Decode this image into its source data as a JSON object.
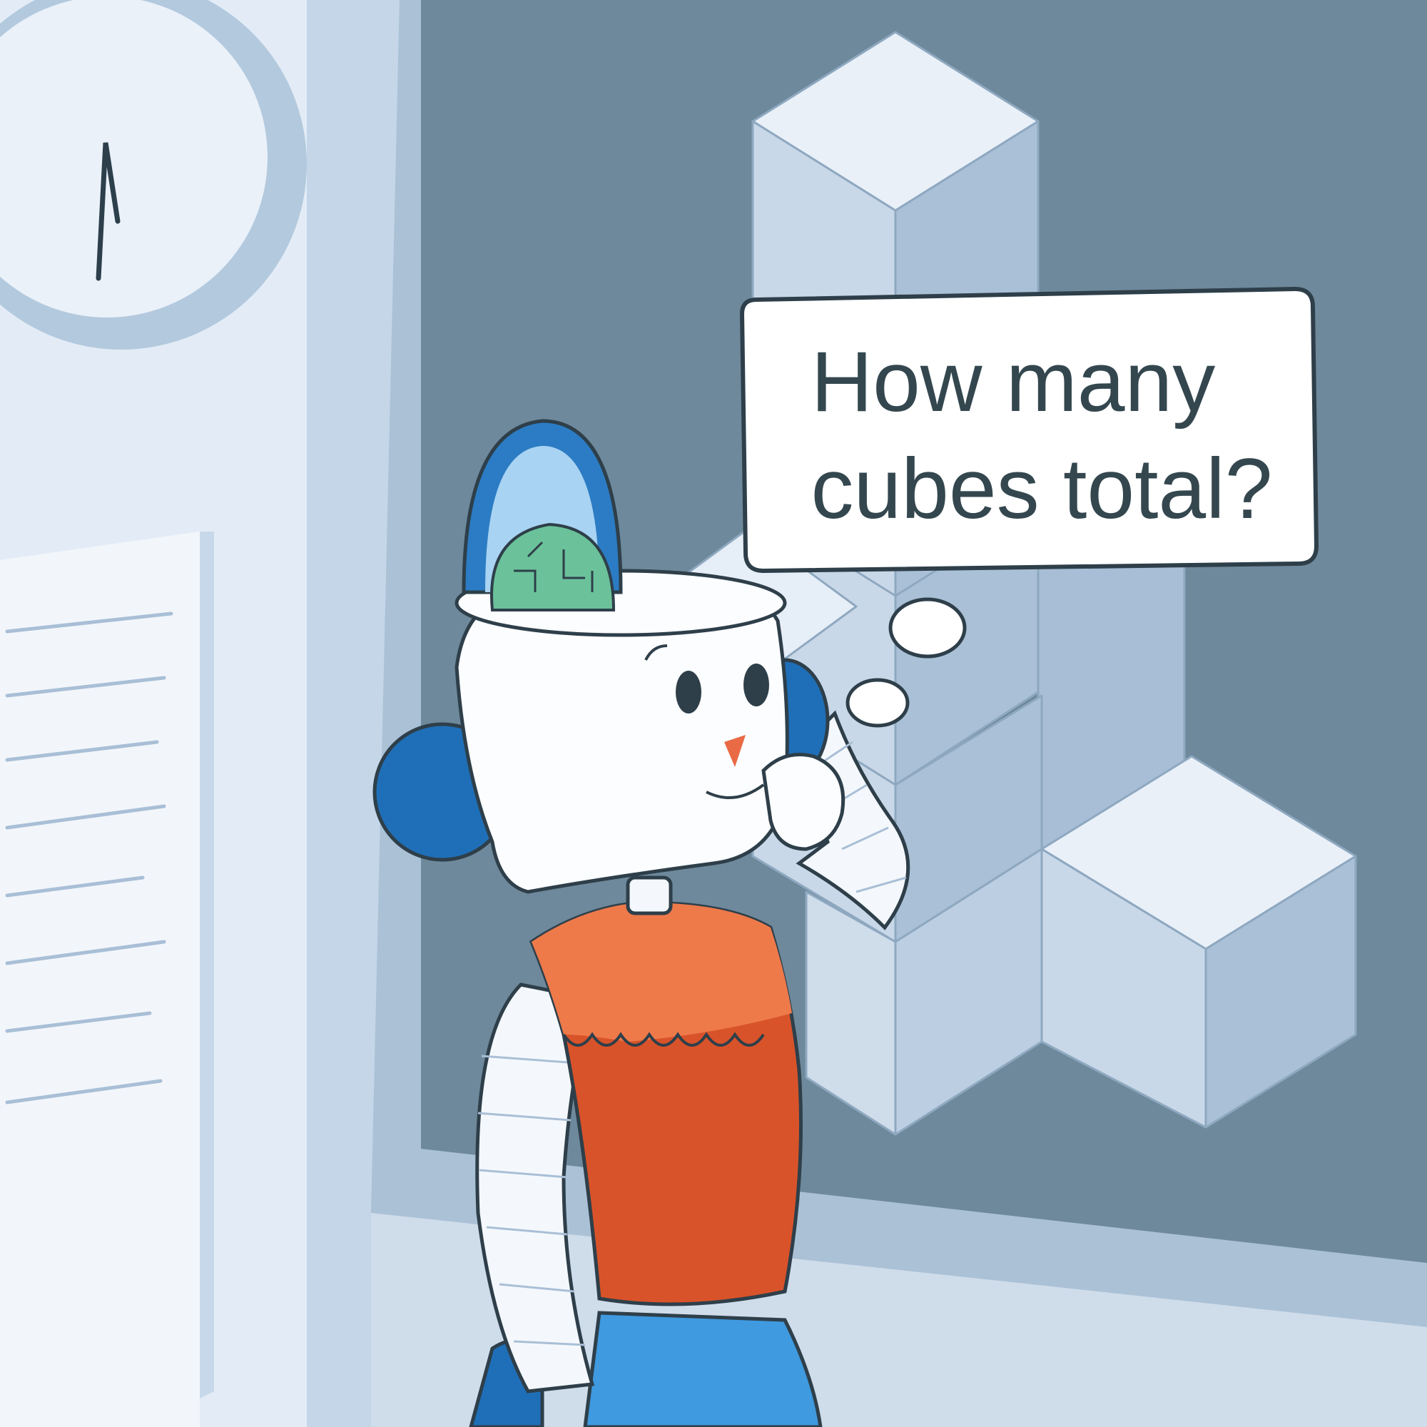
{
  "speech_bubble": {
    "line1": "How many",
    "line2": "cubes total?"
  },
  "colors": {
    "wall": "#dde8f3",
    "wall_shade": "#b9cde0",
    "board": "#6f8a9c",
    "board_frame": "#a9bfd2",
    "cube_top": "#e9f0f8",
    "cube_left": "#c9d8e8",
    "cube_right": "#a8bfd6",
    "outline": "#2e3f4a",
    "robot_white": "#fbfdff",
    "robot_blue": "#1f6fb8",
    "robot_blue_light": "#3f9ae0",
    "vest_orange": "#d9532a",
    "vest_orange_light": "#ee7a4a",
    "chip_green": "#6bc29a",
    "nose": "#e96a45",
    "text": "#34474f"
  },
  "icons": [
    "wall-clock-icon",
    "notice-paper-icon",
    "cube-stack-icon",
    "circuit-brain-icon"
  ]
}
